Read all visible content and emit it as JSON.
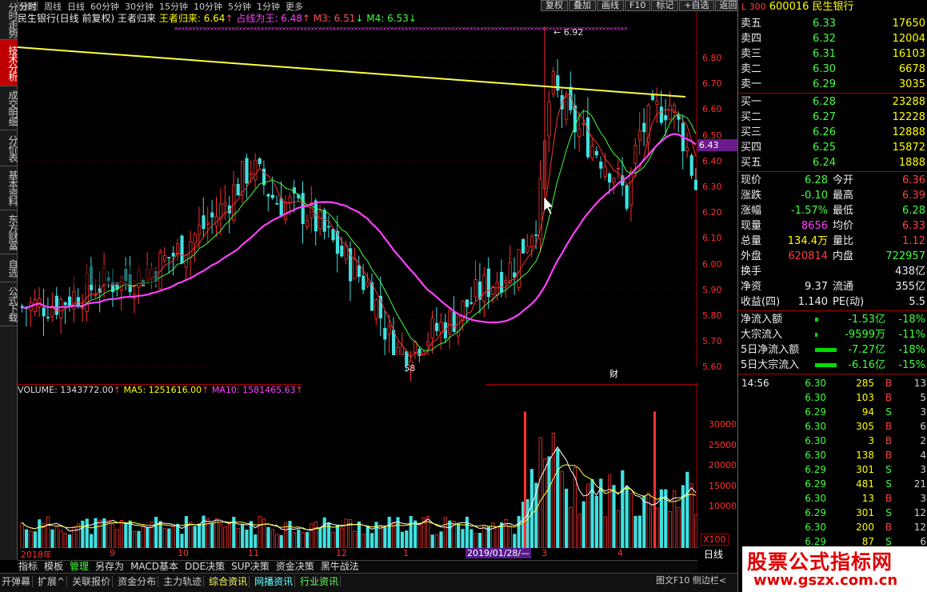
{
  "left_tabs": [
    "分时走势",
    "技术分析",
    "成交明细",
    "分价表",
    "基本资料",
    "东方财富",
    "自选",
    "公式下载"
  ],
  "left_tabs_active": 1,
  "top_bar": [
    "分时",
    "周线",
    "日线",
    "60分钟",
    "30分钟",
    "15分钟",
    "10分钟",
    "5分钟",
    "1分钟",
    "更多"
  ],
  "top_right_buttons": [
    "复权",
    "叠加",
    "画线",
    "F10",
    "标记",
    "+自选",
    "返回"
  ],
  "chart_header": {
    "title": "民生银行(日线 前复权)",
    "indicator": "王者归来",
    "line1": "王者归来: 6.64",
    "line2": "占线为王: 6.48",
    "line3": "M3: 6.51",
    "line4": "M4: 6.53"
  },
  "price_axis": [
    "6.80",
    "6.70",
    "6.60",
    "6.50",
    "6.40",
    "6.30",
    "6.20",
    "6.10",
    "6.00",
    "5.90",
    "5.80",
    "5.70",
    "5.60"
  ],
  "current_price_label": "6.43",
  "high_label": "6.92",
  "low_label": "5.58",
  "vol_header": {
    "volume": "VOLUME: 1343772.00",
    "ma5": "MA5: 1251616.00",
    "ma10": "MA10: 1581465.63"
  },
  "vol_axis": [
    "30000",
    "25000",
    "20000",
    "15000",
    "10000"
  ],
  "vol_unit": "X100",
  "date_axis": [
    "2018年",
    "9",
    "10",
    "11",
    "12",
    "1",
    "3",
    "4"
  ],
  "date_selected": "2019/01/28/—",
  "period": "日线",
  "bottom_tabs": [
    "指标",
    "模板",
    "管理",
    "另存为",
    "MACD基本",
    "DDE决策",
    "SUP决策",
    "资金决策",
    "黑牛战法"
  ],
  "bottom_active": "管理",
  "bottom_bar2": [
    "开弹幕",
    "扩展^",
    "关联报价",
    "资金分布",
    "主力轨迹",
    "综合资讯",
    "网播资讯",
    "行业资讯"
  ],
  "bottom_right": "图文F10  侧边栏<",
  "watermark_small": "财",
  "quote": {
    "code": "600016",
    "name": "民生银行",
    "market": "L 300",
    "sells": [
      {
        "label": "卖五",
        "price": "6.33",
        "vol": "17650"
      },
      {
        "label": "卖四",
        "price": "6.32",
        "vol": "12004"
      },
      {
        "label": "卖三",
        "price": "6.31",
        "vol": "16103"
      },
      {
        "label": "卖二",
        "price": "6.30",
        "vol": "6678"
      },
      {
        "label": "卖一",
        "price": "6.29",
        "vol": "3035"
      }
    ],
    "buys": [
      {
        "label": "买一",
        "price": "6.28",
        "vol": "23288"
      },
      {
        "label": "买二",
        "price": "6.27",
        "vol": "12228"
      },
      {
        "label": "买三",
        "price": "6.26",
        "vol": "12888"
      },
      {
        "label": "买四",
        "price": "6.25",
        "vol": "15872"
      },
      {
        "label": "买五",
        "price": "6.24",
        "vol": "1888"
      }
    ],
    "stats": [
      {
        "l1": "现价",
        "v1": "6.28",
        "c1": "g",
        "l2": "今开",
        "v2": "6.36",
        "c2": "r"
      },
      {
        "l1": "涨跌",
        "v1": "-0.10",
        "c1": "g",
        "l2": "最高",
        "v2": "6.39",
        "c2": "r"
      },
      {
        "l1": "涨幅",
        "v1": "-1.57%",
        "c1": "g",
        "l2": "最低",
        "v2": "6.28",
        "c2": "g"
      },
      {
        "l1": "现量",
        "v1": "8656",
        "c1": "m",
        "l2": "均价",
        "v2": "6.33",
        "c2": "r"
      },
      {
        "l1": "总量",
        "v1": "134.4万",
        "c1": "y",
        "l2": "量比",
        "v2": "1.12",
        "c2": "r"
      },
      {
        "l1": "外盘",
        "v1": "620814",
        "c1": "r",
        "l2": "内盘",
        "v2": "722957",
        "c2": "g"
      },
      {
        "l1": "换手",
        "v1": "",
        "c1": "w",
        "l2": "",
        "v2": "438亿",
        "c2": "w"
      },
      {
        "l1": "净资",
        "v1": "9.37",
        "c1": "w",
        "l2": "流通",
        "v2": "355亿",
        "c2": "w"
      },
      {
        "l1": "收益(四)",
        "v1": "1.140",
        "c1": "w",
        "l2": "PE(动)",
        "v2": "5.5",
        "c2": "w"
      }
    ],
    "flows": [
      {
        "label": "净流入额",
        "value": "-1.53亿",
        "pct": "-18%",
        "bar": 0.08
      },
      {
        "label": "大宗流入",
        "value": "-9599万",
        "pct": "-11%",
        "bar": 0.04
      },
      {
        "label": "5日净流入额",
        "value": "-7.27亿",
        "pct": "-18%",
        "bar": 0.6
      },
      {
        "label": "5日大宗流入",
        "value": "-6.16亿",
        "pct": "-15%",
        "bar": 0.6
      }
    ],
    "ticks_time": "14:56",
    "ticks": [
      {
        "p": "6.30",
        "v": "285",
        "s": "B",
        "c": "13"
      },
      {
        "p": "6.30",
        "v": "103",
        "s": "B",
        "c": "5"
      },
      {
        "p": "6.29",
        "v": "94",
        "s": "S",
        "c": "3"
      },
      {
        "p": "6.30",
        "v": "305",
        "s": "B",
        "c": "6"
      },
      {
        "p": "6.30",
        "v": "3",
        "s": "B",
        "c": "2"
      },
      {
        "p": "6.30",
        "v": "138",
        "s": "B",
        "c": "4"
      },
      {
        "p": "6.29",
        "v": "301",
        "s": "S",
        "c": "3"
      },
      {
        "p": "6.29",
        "v": "481",
        "s": "S",
        "c": "21"
      },
      {
        "p": "6.30",
        "v": "13",
        "s": "B",
        "c": "3"
      },
      {
        "p": "6.29",
        "v": "301",
        "s": "S",
        "c": "12"
      },
      {
        "p": "6.30",
        "v": "200",
        "s": "B",
        "c": "12"
      },
      {
        "p": "6.29",
        "v": "87",
        "s": "S",
        "c": "6"
      }
    ]
  },
  "logo": {
    "line1": "股票公式指标网",
    "line2": "www.gszx.com.cn"
  }
}
